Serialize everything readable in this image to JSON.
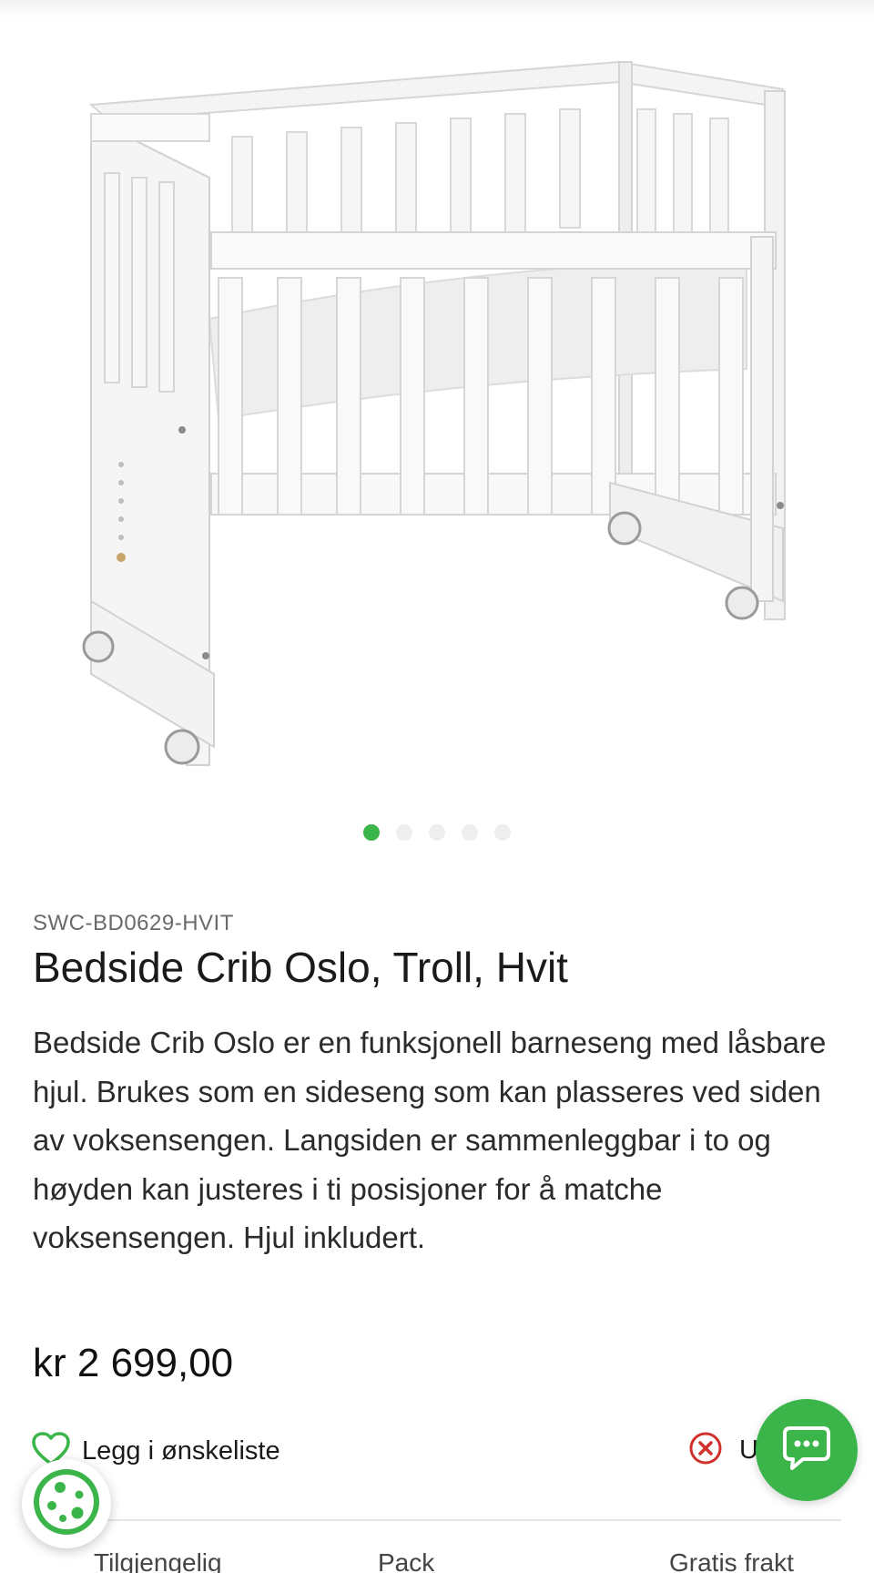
{
  "gallery": {
    "image_alt": "Bedside Crib Oslo, Troll, Hvit",
    "slide_count": 5,
    "active_slide": 1
  },
  "product": {
    "sku": "SWC-BD0629-HVIT",
    "title": "Bedside Crib Oslo, Troll, Hvit",
    "description": "Bedside Crib Oslo er en funksjonell barneseng med låsbare hjul. Brukes som en sideseng som kan plasseres ved siden av voksensengen. Langsiden er sammenleggbar i to og høyden kan justeres i ti posisjoner for å matche voksensengen. Hjul inkludert.",
    "price": "kr 2 699,00"
  },
  "actions": {
    "wishlist_label": "Legg i ønskeliste",
    "stock_label": "U"
  },
  "tabs": [
    "Tilgjengelig",
    "Pack",
    "Gratis frakt"
  ],
  "icons": {
    "wishlist": "heart-outline-icon",
    "stock": "x-circle-icon",
    "chat": "chat-bubble-icon",
    "cookie": "cookie-icon"
  },
  "colors": {
    "accent": "#3bb54a",
    "error": "#d0312d",
    "text": "#1c1c1c",
    "muted": "#6a6a6a"
  }
}
